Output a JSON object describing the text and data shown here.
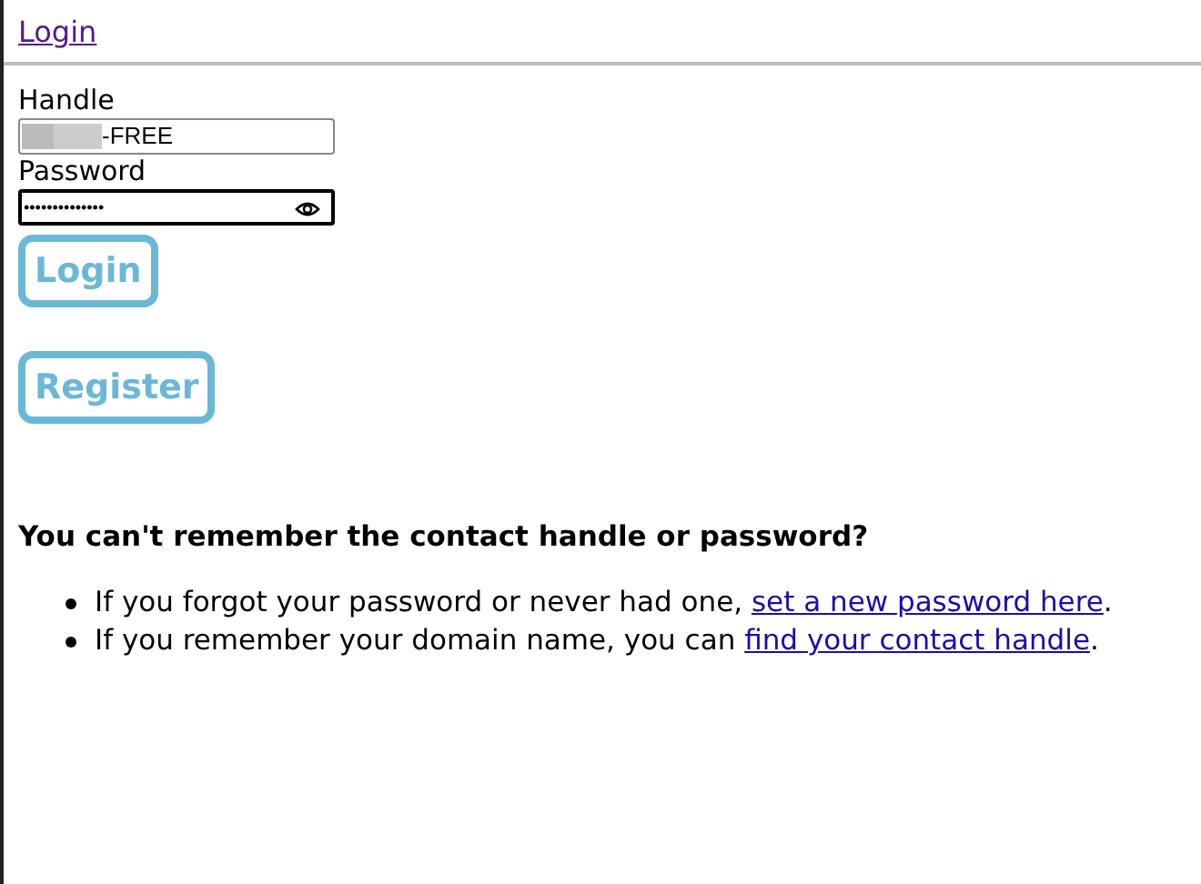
{
  "header": {
    "link": "Login"
  },
  "form": {
    "handle": {
      "label": "Handle",
      "value": "-FREE",
      "redacted": true
    },
    "password": {
      "label": "Password",
      "value": "••••••••••••••",
      "focused": true
    },
    "buttons": [
      "Login",
      "Register"
    ]
  },
  "help": {
    "heading": "You can't remember the contact handle or password?",
    "items": [
      {
        "before": "If you forgot your password or never had one, ",
        "link": "set a new password here",
        "after": "."
      },
      {
        "before": "If you remember your domain name, you can ",
        "link": "find your contact handle",
        "after": "."
      }
    ]
  }
}
